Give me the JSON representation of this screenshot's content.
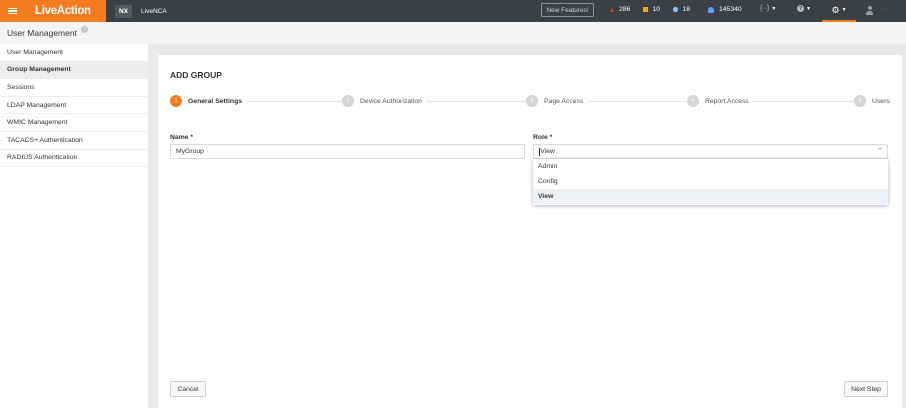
{
  "topbar": {
    "logo": "LiveAction",
    "badge": "NX",
    "product": "LiveNCA",
    "new_features": "New Features!",
    "stats": {
      "critical": "286",
      "warning": "10",
      "info": "18",
      "notifications": "145340"
    },
    "code_icon": "{··}",
    "help_icon": "?"
  },
  "page": {
    "title": "User Management"
  },
  "sidebar": {
    "items": [
      {
        "label": "User Management"
      },
      {
        "label": "Group Management"
      },
      {
        "label": "Sessions"
      },
      {
        "label": "LDAP Management"
      },
      {
        "label": "WMIC Management"
      },
      {
        "label": "TACACS+ Authentication"
      },
      {
        "label": "RADIUS Authentication"
      }
    ]
  },
  "main": {
    "title": "ADD GROUP",
    "steps": [
      {
        "num": "1",
        "label": "General Settings"
      },
      {
        "num": "2",
        "label": "Device Authorization"
      },
      {
        "num": "3",
        "label": "Page Access"
      },
      {
        "num": "4",
        "label": "Report Access"
      },
      {
        "num": "5",
        "label": "Users"
      }
    ],
    "name_label": "Name *",
    "name_value": "MyGroup",
    "role_label": "Role *",
    "role_value": "View",
    "role_options": [
      "Admin",
      "Config",
      "View"
    ],
    "cancel_label": "Cancel",
    "next_label": "Next Step"
  },
  "colors": {
    "accent": "#f47b20",
    "topbar": "#3c3f44",
    "critical": "#e2382f",
    "warning": "#f5a623",
    "info": "#8fc3ff",
    "notify": "#5aa0ff"
  }
}
